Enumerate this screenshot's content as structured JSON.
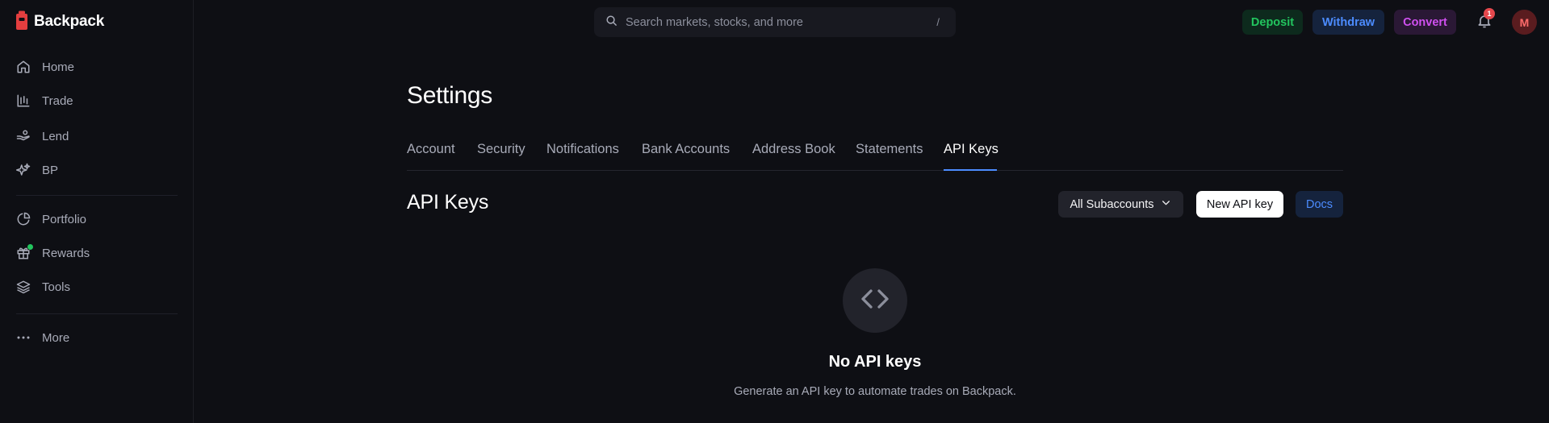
{
  "app": {
    "name": "Backpack",
    "logo_icon": "backpack-logo-icon",
    "brand_color": "#e33e3f"
  },
  "sidebar": {
    "primary": [
      {
        "label": "Home",
        "icon": "home-icon"
      },
      {
        "label": "Trade",
        "icon": "chart-icon"
      },
      {
        "label": "Lend",
        "icon": "hand-coins-icon"
      },
      {
        "label": "BP",
        "icon": "sparkles-icon"
      }
    ],
    "secondary": [
      {
        "label": "Portfolio",
        "icon": "pie-chart-icon"
      },
      {
        "label": "Rewards",
        "icon": "gift-icon",
        "has_indicator": true
      },
      {
        "label": "Tools",
        "icon": "layers-icon"
      }
    ],
    "more": {
      "label": "More",
      "icon": "ellipsis-icon"
    }
  },
  "header": {
    "search": {
      "placeholder": "Search markets, stocks, and more",
      "shortcut": "/"
    },
    "actions": {
      "deposit": "Deposit",
      "withdraw": "Withdraw",
      "convert": "Convert"
    },
    "notifications": {
      "count": "1"
    },
    "avatar_initial": "M"
  },
  "settings": {
    "title": "Settings",
    "tabs": [
      "Account",
      "Security",
      "Notifications",
      "Bank Accounts",
      "Address Book",
      "Statements",
      "API Keys"
    ],
    "active_tab": "API Keys"
  },
  "api_keys": {
    "title": "API Keys",
    "subaccount_filter": "All Subaccounts",
    "new_key_label": "New API key",
    "docs_label": "Docs",
    "empty_state": {
      "icon": "code-icon",
      "title": "No API keys",
      "description": "Generate an API key to automate trades on Backpack."
    }
  },
  "colors": {
    "accent": "#4c8cff",
    "deposit": "#22c55e",
    "convert": "#d050f0",
    "badge": "#e5484d"
  }
}
